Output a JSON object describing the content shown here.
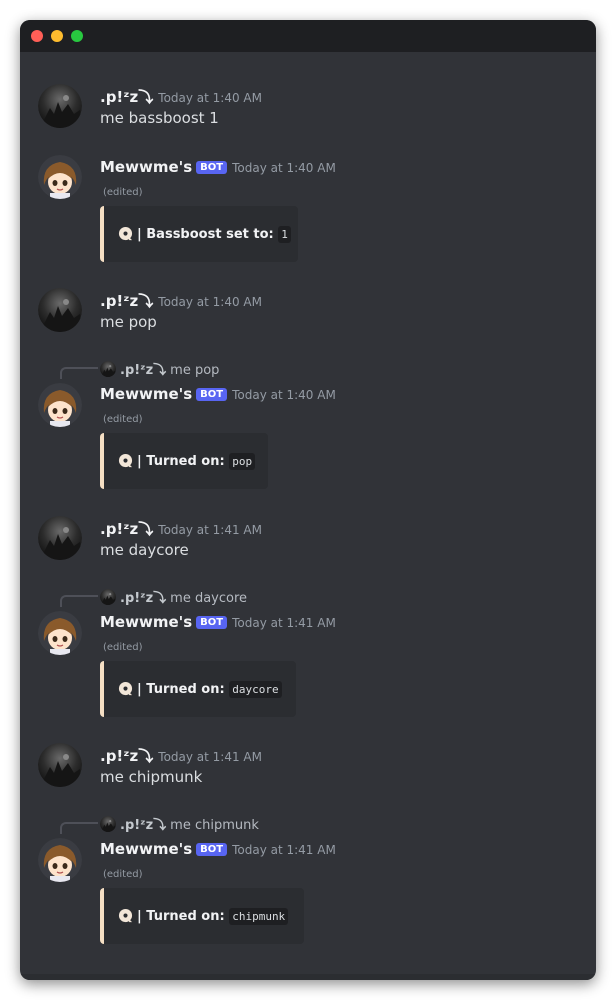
{
  "window": {
    "colors": {
      "background": "#313338",
      "titlebar": "#1e1f22",
      "embed_bar": "#f5dfc4",
      "bot_tag": "#5865f2"
    }
  },
  "messages": [
    {
      "author": ".p!ᶻz⤵",
      "timestamp": "Today at 1:40 AM",
      "text": "me bassboost 1"
    },
    {
      "author": "Mewwme's",
      "bot_tag": "BOT",
      "timestamp": "Today at 1:40 AM",
      "edited": "(edited)",
      "embed": {
        "label": "| Bassboost set to:",
        "code": "1"
      }
    },
    {
      "author": ".p!ᶻz⤵",
      "timestamp": "Today at 1:40 AM",
      "text": "me pop"
    },
    {
      "reply": {
        "author": ".p!ᶻz⤵",
        "text": "me pop"
      },
      "author": "Mewwme's",
      "bot_tag": "BOT",
      "timestamp": "Today at 1:40 AM",
      "edited": "(edited)",
      "embed": {
        "label": "| Turned on:",
        "code": "pop"
      }
    },
    {
      "author": ".p!ᶻz⤵",
      "timestamp": "Today at 1:41 AM",
      "text": "me daycore"
    },
    {
      "reply": {
        "author": ".p!ᶻz⤵",
        "text": "me daycore"
      },
      "author": "Mewwme's",
      "bot_tag": "BOT",
      "timestamp": "Today at 1:41 AM",
      "edited": "(edited)",
      "embed": {
        "label": "| Turned on:",
        "code": "daycore"
      }
    },
    {
      "author": ".p!ᶻz⤵",
      "timestamp": "Today at 1:41 AM",
      "text": "me chipmunk"
    },
    {
      "reply": {
        "author": ".p!ᶻz⤵",
        "text": "me chipmunk"
      },
      "author": "Mewwme's",
      "bot_tag": "BOT",
      "timestamp": "Today at 1:41 AM",
      "edited": "(edited)",
      "embed": {
        "label": "| Turned on:",
        "code": "chipmunk"
      }
    }
  ]
}
